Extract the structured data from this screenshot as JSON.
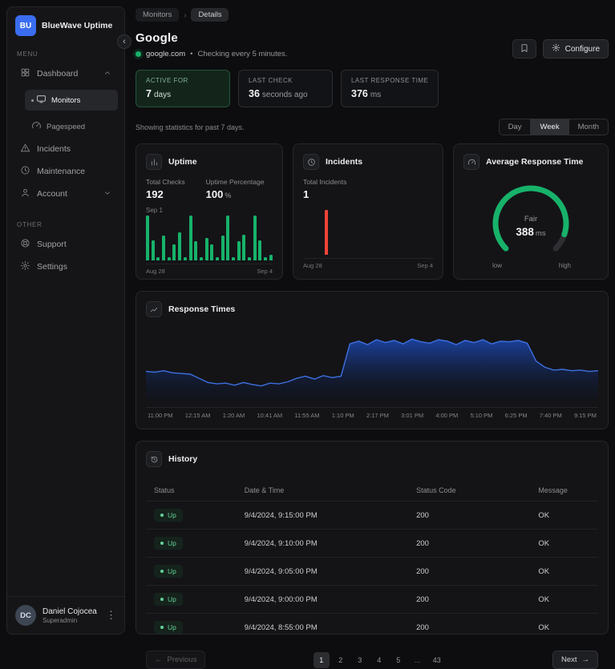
{
  "icons": {
    "breadcrumb_separator": "›",
    "dot_separator": "•",
    "kebab": "⋮",
    "collapse": "‹",
    "prev_arrow": "←",
    "next_arrow": "→"
  },
  "sidebar": {
    "logo_text": "BU",
    "app_name": "BlueWave Uptime",
    "menu_label": "MENU",
    "other_label": "OTHER",
    "items": {
      "dashboard": "Dashboard",
      "monitors": "Monitors",
      "pagespeed": "Pagespeed",
      "incidents": "Incidents",
      "maintenance": "Maintenance",
      "account": "Account",
      "support": "Support",
      "settings": "Settings"
    },
    "user": {
      "initials": "DC",
      "name": "Daniel Cojocea",
      "role": "Superadmin"
    }
  },
  "breadcrumb": {
    "items": [
      "Monitors",
      "Details"
    ]
  },
  "monitor": {
    "title": "Google",
    "url": "google.com",
    "checking_note": "Checking every 5 minutes.",
    "configure_label": "Configure"
  },
  "stats": [
    {
      "label": "ACTIVE FOR",
      "value": "7",
      "unit": "days"
    },
    {
      "label": "LAST CHECK",
      "value": "36",
      "unit": "seconds ago"
    },
    {
      "label": "LAST RESPONSE TIME",
      "value": "376",
      "unit": "ms"
    }
  ],
  "stats_note": "Showing statistics for past 7 days.",
  "range": {
    "options": [
      "Day",
      "Week",
      "Month"
    ],
    "active": "Week"
  },
  "cards": {
    "uptime": {
      "title": "Uptime",
      "metrics": [
        {
          "label": "Total Checks",
          "value": "192",
          "unit": ""
        },
        {
          "label": "Uptime Percentage",
          "value": "100",
          "unit": "%"
        }
      ],
      "annotation": "Sep 1",
      "axis": {
        "start": "Aug 28",
        "end": "Sep 4"
      }
    },
    "incidents": {
      "title": "Incidents",
      "metrics": [
        {
          "label": "Total Incidents",
          "value": "1",
          "unit": ""
        }
      ],
      "axis": {
        "start": "Aug 28",
        "end": "Sep 4"
      }
    },
    "gauge": {
      "title": "Average Response Time",
      "status": "Fair",
      "value": "388",
      "unit": "ms",
      "low_label": "low",
      "high_label": "high"
    },
    "response_times": {
      "title": "Response Times"
    },
    "history": {
      "title": "History"
    }
  },
  "chart_data": [
    {
      "id": "uptime_bars",
      "type": "bar",
      "title": "Uptime (checks per interval, past 7 days)",
      "color": "#17b26a",
      "xlabels": [
        "Aug 28",
        "Sep 4"
      ],
      "values": [
        100,
        45,
        8,
        55,
        8,
        35,
        62,
        8,
        100,
        42,
        8,
        50,
        36,
        8,
        55,
        100,
        8,
        42,
        58,
        8,
        100,
        45,
        8,
        12
      ]
    },
    {
      "id": "incident_bars",
      "type": "bar",
      "title": "Incidents (past 7 days, total 1)",
      "color": "#f04438",
      "xlabels": [
        "Aug 28",
        "Sep 4"
      ],
      "values": [
        0,
        0,
        0,
        0,
        100,
        0,
        0,
        0,
        0,
        0,
        0,
        0,
        0,
        0,
        0,
        0,
        0,
        0,
        0,
        0,
        0,
        0,
        0,
        0
      ]
    },
    {
      "id": "response_gauge",
      "type": "gauge",
      "title": "Average Response Time",
      "status": "Fair",
      "value": 388,
      "unit": "ms",
      "percent": 90,
      "color": "#17b26a"
    },
    {
      "id": "response_area",
      "type": "area",
      "title": "Response Times",
      "color": "#3d6fe0",
      "xlabels": [
        "11:00 PM",
        "12:15 AM",
        "1:20 AM",
        "10:41 AM",
        "11:55 AM",
        "1:10 PM",
        "2:17 PM",
        "3:01 PM",
        "4:00 PM",
        "5:10 PM",
        "6:25 PM",
        "7:40 PM",
        "9:15 PM"
      ],
      "values": [
        40,
        39,
        41,
        38,
        37,
        36,
        30,
        24,
        22,
        23,
        20,
        24,
        21,
        19,
        23,
        22,
        25,
        30,
        33,
        29,
        34,
        31,
        33,
        80,
        84,
        79,
        86,
        82,
        85,
        80,
        87,
        83,
        81,
        86,
        84,
        79,
        85,
        82,
        86,
        80,
        84,
        83,
        85,
        81,
        55,
        46,
        42,
        43,
        41,
        42,
        40,
        41
      ]
    }
  ],
  "history": {
    "columns": [
      "Status",
      "Date & Time",
      "Status Code",
      "Message"
    ],
    "rows": [
      {
        "status": "Up",
        "datetime": "9/4/2024, 9:15:00 PM",
        "code": "200",
        "message": "OK"
      },
      {
        "status": "Up",
        "datetime": "9/4/2024, 9:10:00 PM",
        "code": "200",
        "message": "OK"
      },
      {
        "status": "Up",
        "datetime": "9/4/2024, 9:05:00 PM",
        "code": "200",
        "message": "OK"
      },
      {
        "status": "Up",
        "datetime": "9/4/2024, 9:00:00 PM",
        "code": "200",
        "message": "OK"
      },
      {
        "status": "Up",
        "datetime": "9/4/2024, 8:55:00 PM",
        "code": "200",
        "message": "OK"
      }
    ]
  },
  "pagination": {
    "previous": "Previous",
    "next": "Next",
    "pages": [
      "1",
      "2",
      "3",
      "4",
      "5",
      "...",
      "43"
    ],
    "active": "1"
  }
}
